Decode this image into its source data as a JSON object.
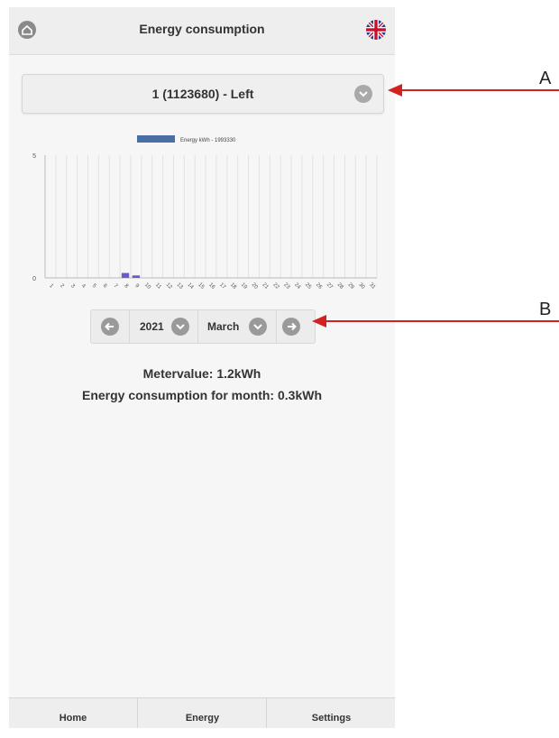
{
  "header": {
    "title": "Energy consumption"
  },
  "meter_select": {
    "value": "1 (1123680) - Left"
  },
  "chart_data": {
    "type": "bar",
    "categories": [
      "1",
      "2",
      "3",
      "4",
      "5",
      "6",
      "7",
      "8",
      "9",
      "10",
      "11",
      "12",
      "13",
      "14",
      "15",
      "16",
      "17",
      "18",
      "19",
      "20",
      "21",
      "22",
      "23",
      "24",
      "25",
      "26",
      "27",
      "28",
      "29",
      "30",
      "31"
    ],
    "series": [
      {
        "name": "Energy kWh - 1993330",
        "values": [
          0,
          0,
          0,
          0,
          0,
          0,
          0,
          0.2,
          0.1,
          0,
          0,
          0,
          0,
          0,
          0,
          0,
          0,
          0,
          0,
          0,
          0,
          0,
          0,
          0,
          0,
          0,
          0,
          0,
          0,
          0,
          0
        ]
      }
    ],
    "ylim": [
      0,
      5
    ],
    "yticks": [
      "0",
      "5"
    ],
    "legend_position": "top-center",
    "grid": true,
    "color": "#4a6fa5"
  },
  "date_nav": {
    "year": "2021",
    "month": "March"
  },
  "info": {
    "metervalue": "Metervalue: 1.2kWh",
    "month_consumption": "Energy consumption for month: 0.3kWh"
  },
  "tabs": [
    {
      "label": "Home"
    },
    {
      "label": "Energy"
    },
    {
      "label": "Settings"
    }
  ],
  "annotations": {
    "a": "A",
    "b": "B",
    "arrow_color": "#d32020"
  }
}
